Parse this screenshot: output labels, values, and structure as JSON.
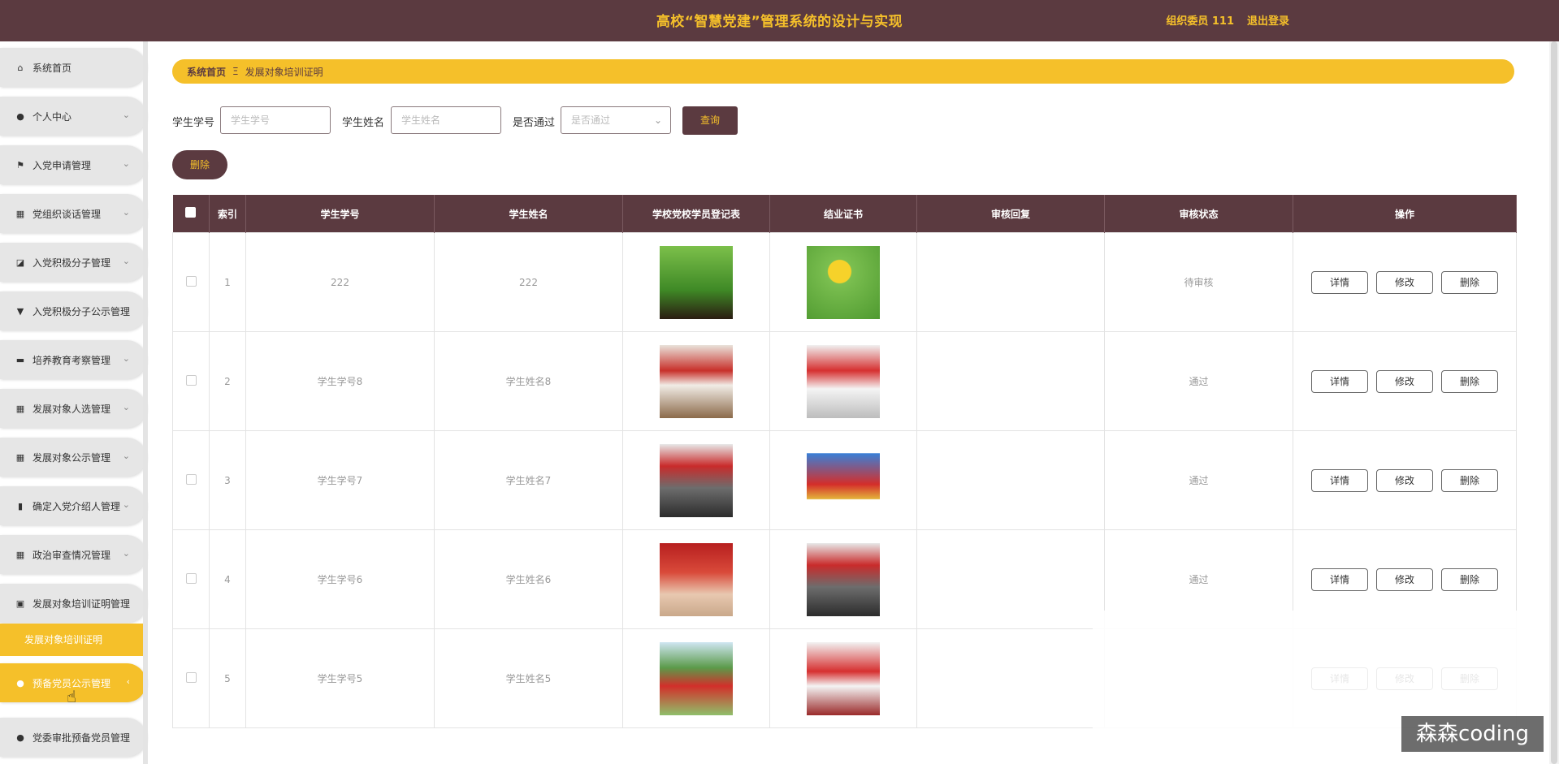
{
  "header": {
    "title": "高校“智慧党建”管理系统的设计与实现",
    "user": "组织委员 111",
    "logout": "退出登录"
  },
  "sidebar": {
    "items": [
      {
        "label": "系统首页",
        "icon": "home-icon"
      },
      {
        "label": "个人中心",
        "icon": "user-icon"
      },
      {
        "label": "入党申请管理",
        "icon": "flag-icon"
      },
      {
        "label": "党组织谈话管理",
        "icon": "grid-icon"
      },
      {
        "label": "入党积极分子管理",
        "icon": "chart-icon"
      },
      {
        "label": "入党积极分子公示管理",
        "icon": "pin-icon"
      },
      {
        "label": "培养教育考察管理",
        "icon": "briefcase-icon"
      },
      {
        "label": "发展对象人选管理",
        "icon": "grid-icon"
      },
      {
        "label": "发展对象公示管理",
        "icon": "grid-icon"
      },
      {
        "label": "确定入党介绍人管理",
        "icon": "bar-chart-icon"
      },
      {
        "label": "政治审查情况管理",
        "icon": "grid-icon"
      },
      {
        "label": "发展对象培训证明管理",
        "icon": "clipboard-icon"
      },
      {
        "label": "预备党员公示管理",
        "icon": "user-icon"
      },
      {
        "label": "党委审批预备党员管理",
        "icon": "bulb-icon"
      }
    ],
    "submenu": "发展对象培训证明"
  },
  "breadcrumb": {
    "home": "系统首页",
    "separator": "Ξ",
    "current": "发展对象培训证明"
  },
  "search": {
    "student_id_label": "学生学号",
    "student_id_placeholder": "学生学号",
    "student_name_label": "学生姓名",
    "student_name_placeholder": "学生姓名",
    "passed_label": "是否通过",
    "passed_placeholder": "是否通过",
    "query_button": "查询"
  },
  "actions": {
    "delete_button": "删除"
  },
  "table": {
    "headers": [
      "索引",
      "学生学号",
      "学生姓名",
      "学校党校学员登记表",
      "结业证书",
      "审核回复",
      "审核状态",
      "操作"
    ],
    "rows": [
      {
        "index": "1",
        "id": "222",
        "name": "222",
        "reply": "",
        "status": "待审核"
      },
      {
        "index": "2",
        "id": "学生学号8",
        "name": "学生姓名8",
        "reply": "",
        "status": "通过"
      },
      {
        "index": "3",
        "id": "学生学号7",
        "name": "学生姓名7",
        "reply": "",
        "status": "通过"
      },
      {
        "index": "4",
        "id": "学生学号6",
        "name": "学生姓名6",
        "reply": "",
        "status": "通过"
      },
      {
        "index": "5",
        "id": "学生学号5",
        "name": "学生姓名5",
        "reply": "",
        "status": ""
      }
    ],
    "op_detail": "详情",
    "op_edit": "修改",
    "op_delete": "删除"
  },
  "watermark": "森森coding",
  "colors": {
    "primary": "#5b3a40",
    "accent": "#f5c02a"
  }
}
